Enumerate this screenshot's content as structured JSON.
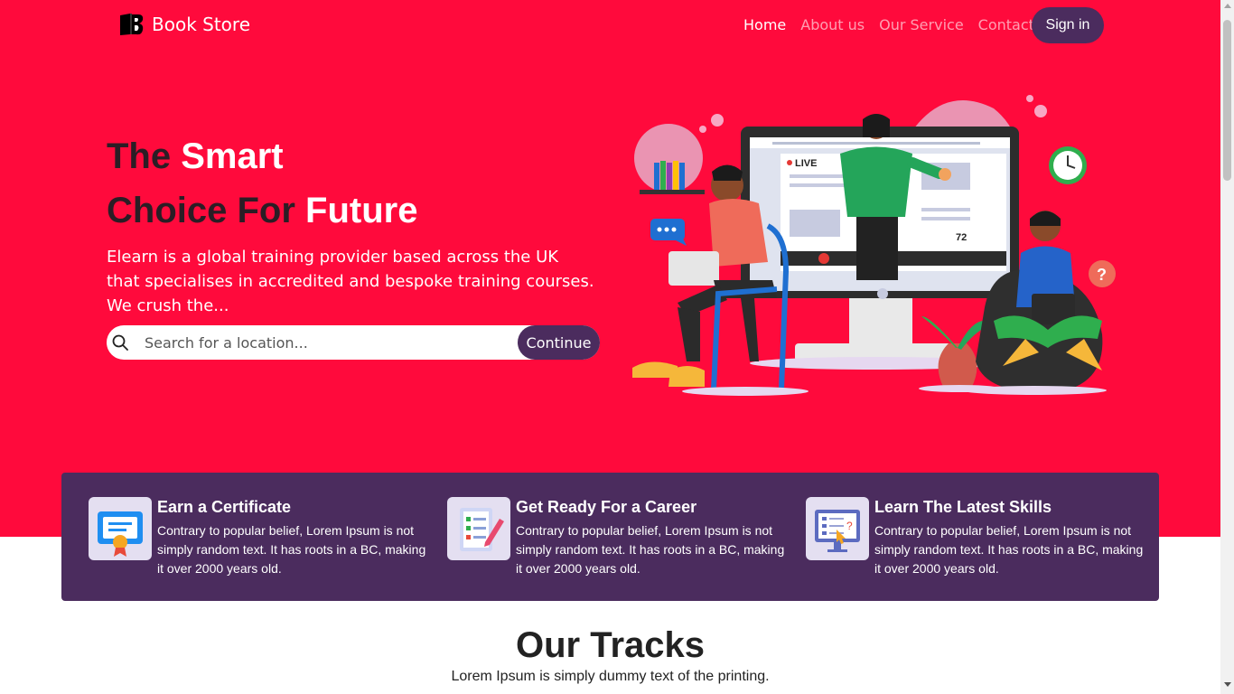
{
  "brand": {
    "name": "Book Store",
    "icon": "book-logo-icon"
  },
  "nav": {
    "items": [
      {
        "label": "Home",
        "active": true
      },
      {
        "label": "About us",
        "active": false
      },
      {
        "label": "Our Service",
        "active": false
      },
      {
        "label": "Contact us",
        "active": false
      }
    ],
    "signin_label": "Sign in"
  },
  "hero": {
    "line1_dark": "The",
    "line1_light": "Smart",
    "line2_dark": "Choice For",
    "line2_light": "Future",
    "description": "Elearn is a global training provider based across the UK that specialises in accredited and bespoke training courses. We crush the...",
    "search_placeholder": "Search for a location...",
    "continue_label": "Continue",
    "illustration": {
      "live_label": "LIVE",
      "viewer_count": "72"
    }
  },
  "features": [
    {
      "title": "Earn a Certificate",
      "text": "Contrary to popular belief, Lorem Ipsum is not simply random text. It has roots in a BC, making it over 2000 years old.",
      "icon": "certificate-icon"
    },
    {
      "title": "Get Ready For a Career",
      "text": "Contrary to popular belief, Lorem Ipsum is not simply random text. It has roots in a BC, making it over 2000 years old.",
      "icon": "checklist-icon"
    },
    {
      "title": "Learn The Latest Skills",
      "text": "Contrary to popular belief, Lorem Ipsum is not simply random text. It has roots in a BC, making it over 2000 years old.",
      "icon": "monitor-quiz-icon"
    }
  ],
  "tracks": {
    "title": "Our Tracks",
    "subtitle": "Lorem Ipsum is simply dummy text of the printing."
  },
  "colors": {
    "hero_bg": "#ff0a3c",
    "accent_purple": "#4b2c5e",
    "dark_text": "#2b1d25"
  }
}
